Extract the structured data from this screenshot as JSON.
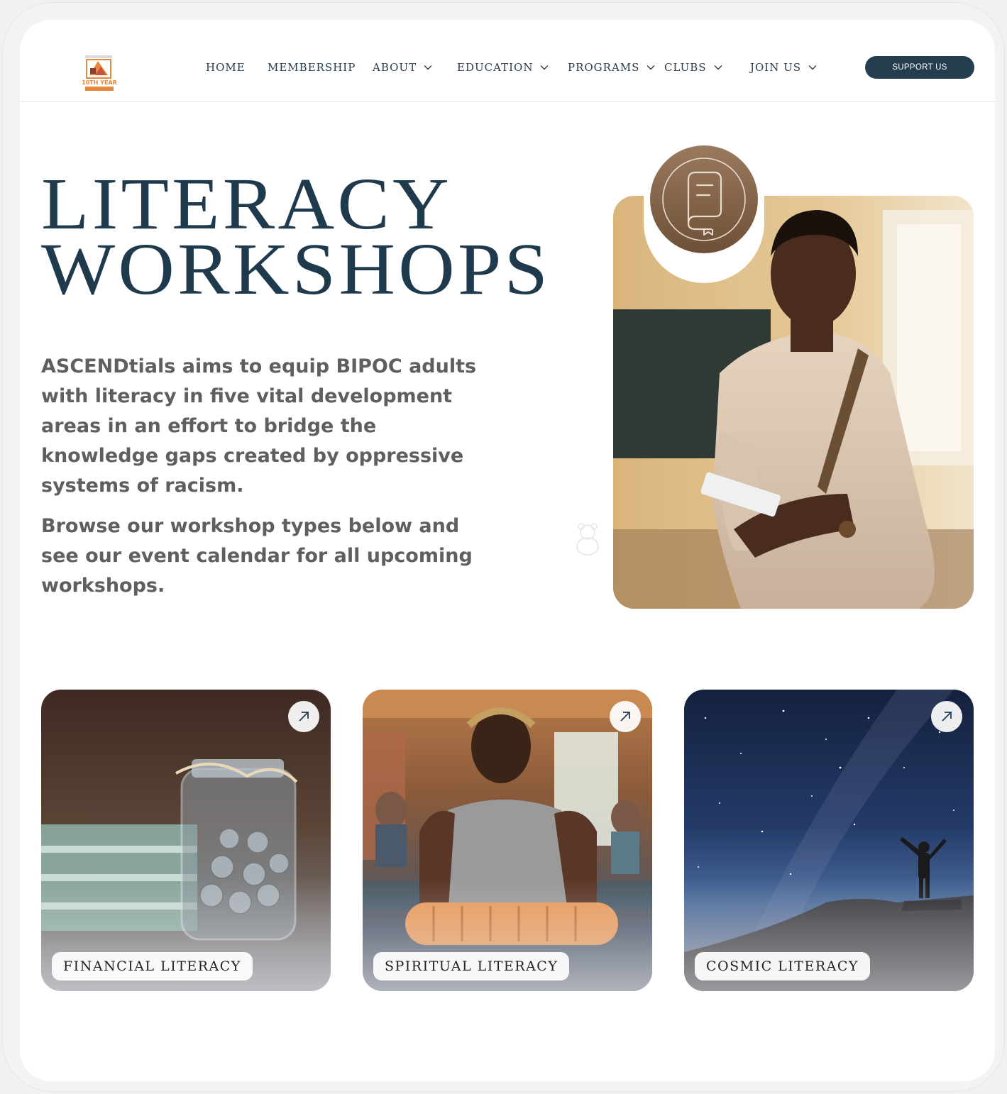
{
  "header": {
    "logo_alt": "ASCENDtials 10th Year Anniversary",
    "nav": [
      {
        "label": "HOME",
        "has_dropdown": false
      },
      {
        "label": "MEMBERSHIP",
        "has_dropdown": false
      },
      {
        "label": "ABOUT",
        "has_dropdown": true
      },
      {
        "label": "EDUCATION",
        "has_dropdown": true
      },
      {
        "label": "PROGRAMS",
        "has_dropdown": true
      },
      {
        "label": "CLUBS",
        "has_dropdown": true
      },
      {
        "label": "JOIN US",
        "has_dropdown": true
      }
    ],
    "support_label": "SUPPORT US"
  },
  "hero": {
    "title_line1": "LITERACY",
    "title_line2": "WORKSHOPS",
    "paragraph1": "ASCENDtials aims to equip BIPOC adults with literacy in five vital development areas in an effort to bridge the knowledge gaps created by oppressive systems of racism.",
    "paragraph2": "Browse our workshop types below and see our event calendar for all upcoming workshops.",
    "badge_icon": "book-icon"
  },
  "cards": [
    {
      "label": "FINANCIAL LITERACY",
      "icon": "arrow-up-right-icon"
    },
    {
      "label": "SPIRITUAL LITERACY",
      "icon": "arrow-up-right-icon"
    },
    {
      "label": "COSMIC LITERACY",
      "icon": "arrow-up-right-icon"
    }
  ],
  "colors": {
    "brand_navy": "#1f3a4d",
    "button_bg": "#243d4f",
    "body_text": "#5f5f5f",
    "badge_brown": "#7d5e44",
    "logo_orange": "#e8883a"
  }
}
